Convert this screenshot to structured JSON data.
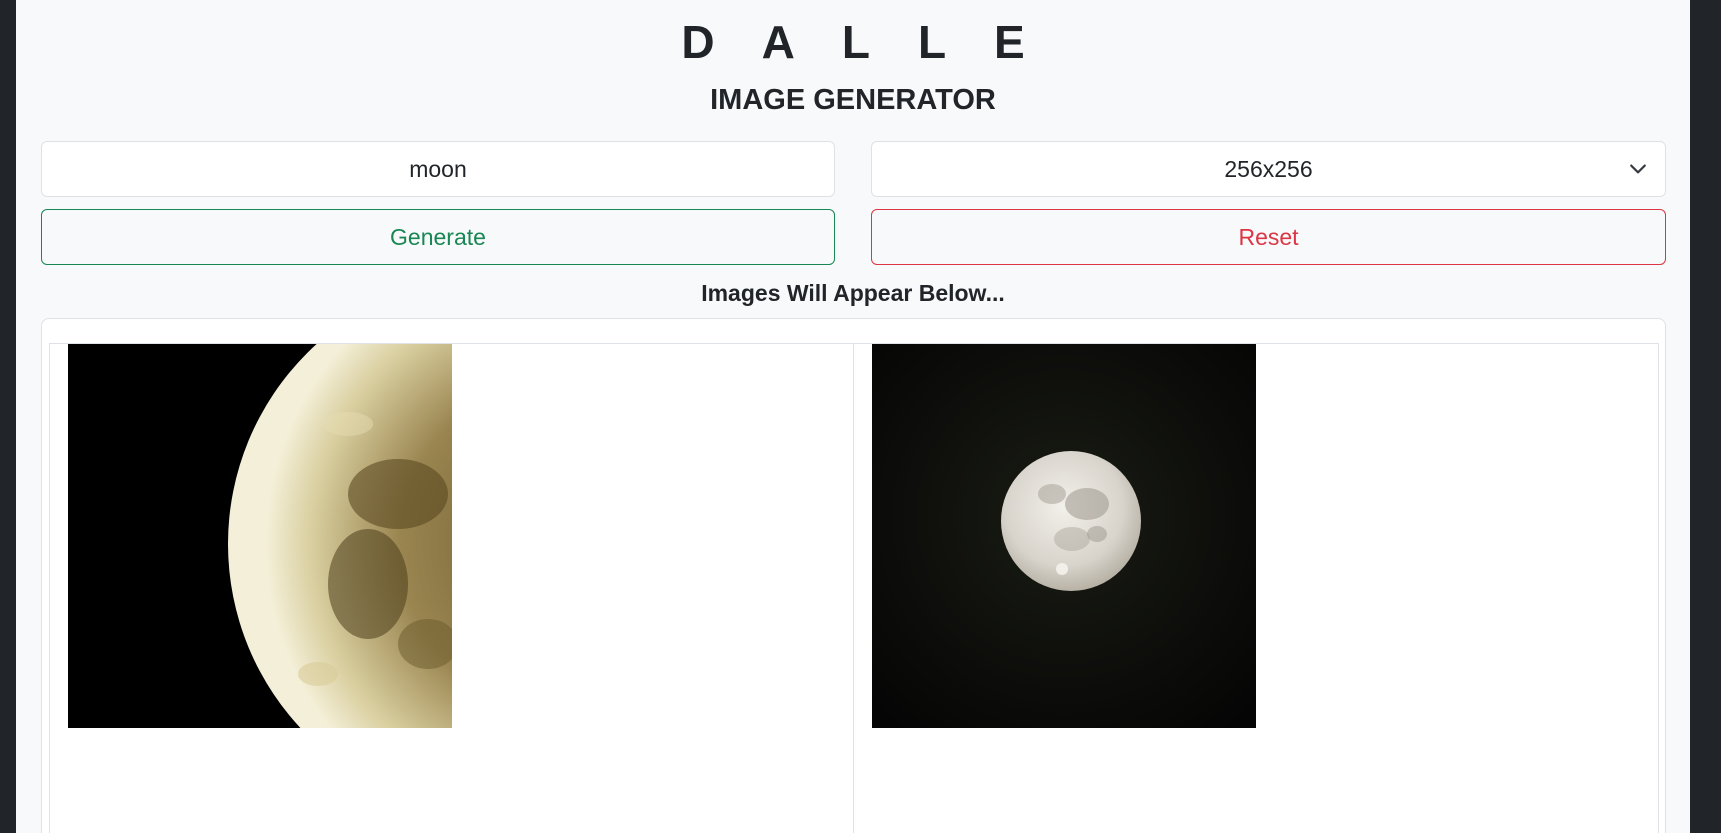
{
  "header": {
    "brand": "D A L L E",
    "subtitle": "IMAGE GENERATOR"
  },
  "form": {
    "prompt_value": "moon",
    "size_selected": "256x256",
    "generate_label": "Generate",
    "reset_label": "Reset"
  },
  "results": {
    "notice": "Images Will Appear Below...",
    "images": [
      {
        "subject": "moon-closeup-image"
      },
      {
        "subject": "full-moon-image"
      }
    ]
  },
  "colors": {
    "generate": "#198754",
    "reset": "#dc3545",
    "page_bg": "#f8f9fa",
    "frame_bg": "#212529"
  },
  "icons": {
    "select": "chevron-down-icon"
  }
}
